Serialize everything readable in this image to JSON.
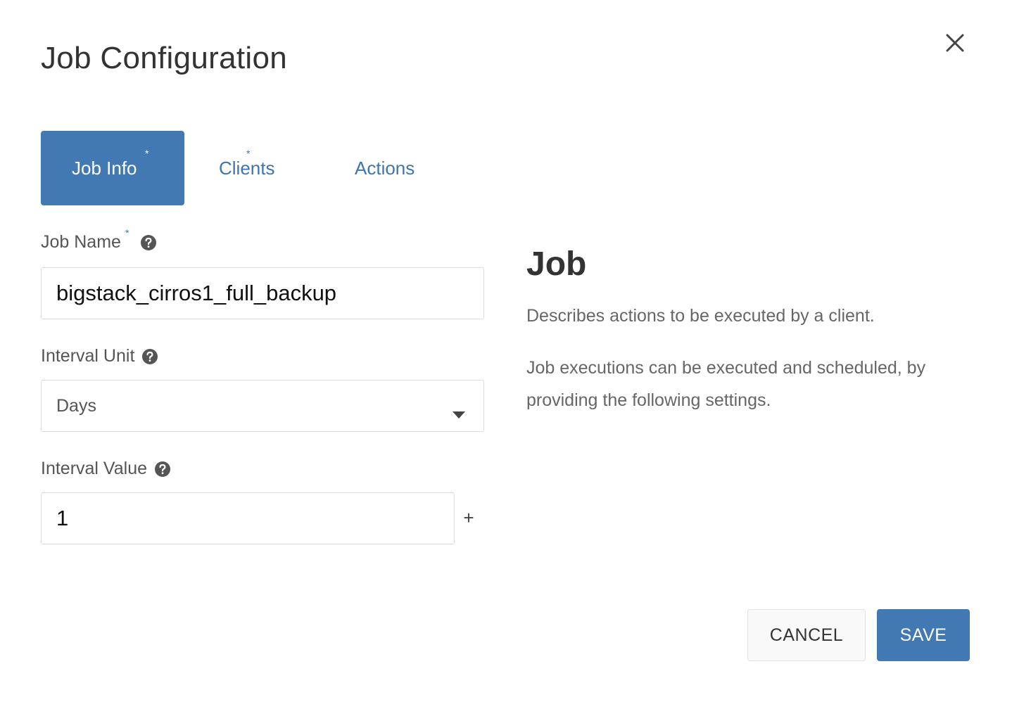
{
  "dialog": {
    "title": "Job Configuration"
  },
  "tabs": [
    {
      "label": "Job Info",
      "required": "*",
      "active": true
    },
    {
      "label": "Clients",
      "required": "*",
      "active": false
    },
    {
      "label": "Actions",
      "active": false
    }
  ],
  "form": {
    "job_name": {
      "label": "Job Name",
      "required": "*",
      "value": "bigstack_cirros1_full_backup"
    },
    "interval_unit": {
      "label": "Interval Unit",
      "value": "Days"
    },
    "interval_value": {
      "label": "Interval Value",
      "value": "1",
      "increment_label": "+"
    }
  },
  "info": {
    "title": "Job",
    "paragraph1": "Describes actions to be executed by a client.",
    "paragraph2": "Job executions can be executed and scheduled, by providing the following settings."
  },
  "footer": {
    "cancel_label": "CANCEL",
    "save_label": "SAVE"
  },
  "icons": {
    "close": "close-icon",
    "help": "help-icon",
    "dropdown": "caret-down-icon"
  },
  "colors": {
    "accent": "#4279b3",
    "text": "#333333"
  }
}
